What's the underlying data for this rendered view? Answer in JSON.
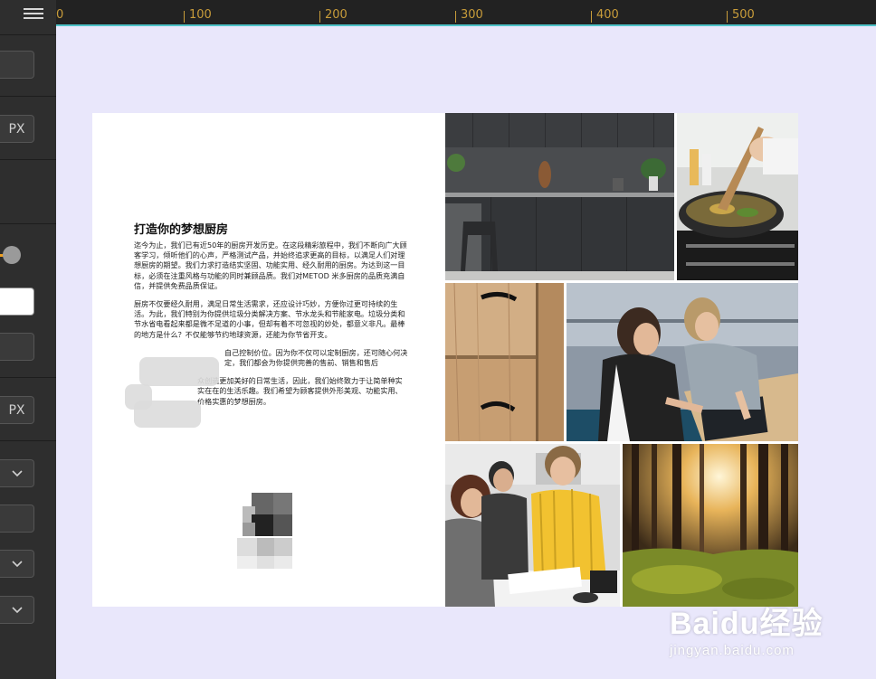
{
  "sidebar": {
    "unit_top": "PX",
    "unit_bottom": "PX",
    "dropdown_icon": "chevron-down-icon",
    "menu_icon": "hamburger-menu-icon"
  },
  "ruler": {
    "labels": [
      "0",
      "100",
      "200",
      "300",
      "400",
      "500"
    ]
  },
  "document": {
    "title": "打造你的梦想厨房",
    "paragraph1": "迄今为止，我们已有近50年的厨房开发历史。在这段精彩旅程中，我们不断向广大顾客学习，倾听他们的心声，严格测试产品，并始终追求更高的目标，以满足人们对理想厨房的期望。我们力求打造结实坚固、功能实用、经久耐用的厨房。为达到这一目标，必须在注重风格与功能的同时兼顾品质。我们对METOD 米多厨房的品质充满自信，并提供免费品质保证。",
    "paragraph2": "厨房不仅要经久耐用，满足日常生活需求，还应设计巧妙，方便你过更可持续的生活。为此，我们特别为你提供垃圾分类解决方案、节水龙头和节能家电。垃圾分类和节水省电看起来都是微不足道的小事，但却有着不可忽视的妙处，都意义非凡。最棒的地方是什么？不仅能够节约地球资源，还能为你节省开支。",
    "paragraph3": "自己控制价位。因为你不仅可以定制厨房，还可随心何决定，我们都会为你提供完善的售前、销售和售后",
    "paragraph4": "众创造更加美好的日常生活，因此，我们始终致力于让简单种实实在在的生活乐趣。我们希望为顾客提供外形美观、功能实用、价格实惠的梦想厨房。"
  },
  "photos": {
    "p1": "dark-kitchen-photo",
    "p2": "wok-cooking-photo",
    "p3": "wood-drawers-photo",
    "p4": "two-women-tablet-photo",
    "p5": "store-consultation-photo",
    "p6": "sunlit-forest-photo"
  },
  "watermark": {
    "brand": "Baidu经验",
    "url": "jingyan.baidu.com"
  }
}
